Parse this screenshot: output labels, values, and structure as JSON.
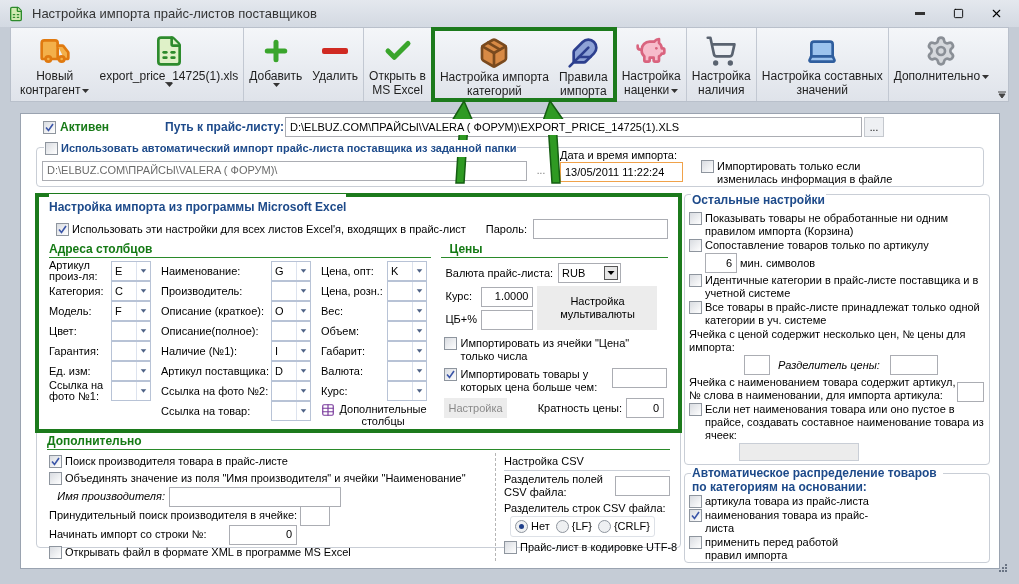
{
  "window": {
    "title": "Настройка импорта прайс-листов поставщиков"
  },
  "toolbar": {
    "groups": [
      [
        {
          "lines": [
            "Новый",
            "контрагент"
          ],
          "menu": true,
          "highlighted": false
        },
        {
          "lines": [
            "export_price_14725(1).xls"
          ],
          "menu": true,
          "kind": "split",
          "highlighted": false
        }
      ],
      [
        {
          "lines": [
            "Добавить"
          ],
          "menu": true,
          "kind": "split",
          "highlighted": false
        },
        {
          "lines": [
            "Удалить"
          ],
          "menu": false,
          "highlighted": false
        }
      ],
      [
        {
          "lines": [
            "Открыть в",
            "MS Excel"
          ],
          "menu": false,
          "highlighted": false
        },
        {
          "lines": [
            "Настройка импорта",
            "категорий"
          ],
          "menu": false,
          "highlighted": true
        },
        {
          "lines": [
            "Правила",
            "импорта"
          ],
          "menu": false,
          "highlighted": true
        },
        {
          "lines": [
            "Настройка",
            "наценки"
          ],
          "menu": true,
          "highlighted": false
        }
      ],
      [
        {
          "lines": [
            "Настройка",
            "наличия"
          ],
          "menu": false,
          "highlighted": false
        }
      ],
      [
        {
          "lines": [
            "Настройка составных",
            "значений"
          ],
          "menu": false,
          "highlighted": false
        }
      ],
      [
        {
          "lines": [
            "Дополнительно"
          ],
          "menu": true,
          "highlighted": false
        }
      ]
    ]
  },
  "active": {
    "label": "Активен",
    "checked": true
  },
  "path": {
    "label": "Путь к прайс-листу:",
    "value": "D:\\ELBUZ.COM\\ПРАЙСЫ\\VALERA ( ФОРУМ)\\EXPORT_PRICE_14725(1).XLS",
    "browse": "..."
  },
  "auto_import": {
    "label": "Использовать автоматический импорт прайс-листа поставщика из заданной папки",
    "checked": false,
    "folder": "D:\\ELBUZ.COM\\ПРАЙСЫ\\VALERA ( ФОРУМ)\\",
    "browse": "...",
    "datetime_label": "Дата и время импорта:",
    "datetime": "13/05/2011 11:22:24",
    "only_if_changed": {
      "label": "Импортировать только если изменилась информация в файле",
      "checked": false
    }
  },
  "excel": {
    "highlighted": true,
    "title": "Настройка импорта из программы Microsoft Excel",
    "all_sheets": {
      "label": "Использовать эти настройки для всех листов Excel'я, входящих в прайс-лист",
      "checked": true
    },
    "password_label": "Пароль:",
    "columns_title": "Адреса столбцов",
    "columns": [
      [
        {
          "label": "Артикул произ-ля:",
          "value": "E"
        },
        {
          "label": "Категория:",
          "value": "C"
        },
        {
          "label": "Модель:",
          "value": "F"
        },
        {
          "label": "Цвет:"
        },
        {
          "label": "Гарантия:"
        },
        {
          "label": "Ед. изм:"
        },
        {
          "label": "Ссылка на фото №1:"
        }
      ],
      [
        {
          "label": "Наименование:",
          "value": "G"
        },
        {
          "label": "Производитель:"
        },
        {
          "label": "Описание (краткое):",
          "value": "O"
        },
        {
          "label": "Описание(полное):"
        },
        {
          "label": "Наличие (№1):",
          "value": "I"
        },
        {
          "label": "Артикул поставщика:",
          "value": "D"
        },
        {
          "label": "Ссылка на фото №2:"
        },
        {
          "label": "Ссылка на товар:"
        }
      ],
      [
        {
          "label": "Цена, опт:",
          "value": "K"
        },
        {
          "label": "Цена, розн.:"
        },
        {
          "label": "Вес:"
        },
        {
          "label": "Объем:"
        },
        {
          "label": "Габарит:"
        },
        {
          "label": "Валюта:"
        },
        {
          "label": "Курс:"
        }
      ]
    ],
    "extra_columns": "Дополнительные столбцы",
    "prices": {
      "title": "Цены",
      "currency_label": "Валюта прайс-листа:",
      "currency": "RUB",
      "rate_label": "Курс:",
      "rate": "1.0000",
      "cb_label": "ЦБ+%",
      "multicurrency_button": "Настройка мультивалюты",
      "numbers_only": {
        "label": "Импортировать из ячейки \"Цена\" только числа",
        "checked": false
      },
      "min_price": {
        "label": "Импортировать товары у которых цена больше чем:",
        "checked": true
      },
      "setup_button": {
        "label": "Настройка",
        "disabled": true
      },
      "multiplicity_label": "Кратность цены:",
      "multiplicity": "0"
    }
  },
  "extra": {
    "title": "Дополнительно",
    "manufacturer_search": {
      "label": "Поиск производителя товара в прайс-листе",
      "checked": true
    },
    "merge": {
      "label": "Объединять значение из поля \"Имя производителя\" и ячейки \"Наименование\"",
      "checked": false
    },
    "manufacturer_name_label": "Имя производителя:",
    "forced_search_label": "Принудительный поиск производителя в ячейке:",
    "start_row_label": "Начинать импорт со строки №:",
    "start_row": "0",
    "open_xml": {
      "label": "Открывать файл в формате XML в программе MS Excel",
      "checked": false
    },
    "csv": {
      "title": "Настройка CSV",
      "field_sep_label": "Разделитель полей CSV файла:",
      "row_sep_label": "Разделитель строк CSV файла:",
      "row_separators": [
        {
          "label": "Нет",
          "selected": true
        },
        {
          "label": "{LF}",
          "selected": false
        },
        {
          "label": "{CRLF}",
          "selected": false
        }
      ],
      "utf8": {
        "label": "Прайс-лист в кодировке UTF-8",
        "checked": false
      }
    }
  },
  "other": {
    "title": "Остальные настройки",
    "show_basket": {
      "label": "Показывать товары не обработанные ни одним правилом импорта (Корзина)",
      "checked": false
    },
    "by_article": {
      "label": "Сопоставление товаров только по артикулу",
      "checked": false
    },
    "min_chars": "6",
    "min_chars_label": "мин. символов",
    "same_categories": {
      "label": "Идентичные категории в прайс-листе поставщика и в учетной системе",
      "checked": false
    },
    "one_category": {
      "label": "Все товары в прайс-листе принадлежат только одной категории в уч. системе",
      "checked": false
    },
    "multi_price_label": "Ячейка с ценой содержит несколько цен, № цены для импорта:",
    "price_sep_label": "Разделитель цены:",
    "article_word_label": "Ячейка с наименованием товара содержит артикул, № слова в наименовании, для импорта артикула:",
    "compose_name": {
      "label": "Если нет наименования товара или оно пустое в прайсе, создавать составное наименование товара из ячеек:",
      "checked": false
    }
  },
  "auto_distribution": {
    "title": "Автоматическое распределение товаров по категориям на основании:",
    "items": [
      {
        "label": "артикула товара из прайс-листа",
        "checked": false
      },
      {
        "label": "наименования товара из прайс-листа",
        "checked": true
      },
      {
        "label": "применить перед работой правил импорта",
        "checked": false
      }
    ]
  }
}
